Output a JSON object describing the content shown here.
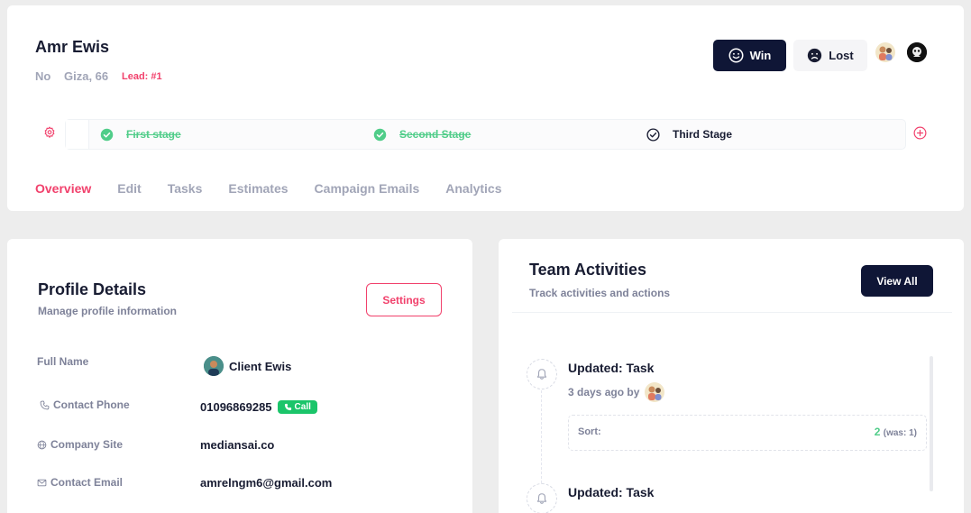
{
  "header": {
    "name": "Amr Ewis",
    "meta_no": "No",
    "meta_address": "Giza, 66",
    "lead": "Lead: #1",
    "win_label": "Win",
    "lost_label": "Lost"
  },
  "stages": [
    {
      "label": "First stage",
      "status": "done"
    },
    {
      "label": "Second Stage",
      "status": "done"
    },
    {
      "label": "Third Stage",
      "status": "current"
    }
  ],
  "tabs": [
    {
      "label": "Overview",
      "active": true
    },
    {
      "label": "Edit",
      "active": false
    },
    {
      "label": "Tasks",
      "active": false
    },
    {
      "label": "Estimates",
      "active": false
    },
    {
      "label": "Campaign Emails",
      "active": false
    },
    {
      "label": "Analytics",
      "active": false
    }
  ],
  "profile": {
    "title": "Profile Details",
    "subtitle": "Manage profile information",
    "settings_label": "Settings",
    "full_name_label": "Full Name",
    "full_name": "Client Ewis",
    "phone_label": "Contact Phone",
    "phone": "01096869285",
    "call_label": "Call",
    "site_label": "Company Site",
    "site": "mediansai.co",
    "email_label": "Contact Email",
    "email": "amrelngm6@gmail.com"
  },
  "team": {
    "title": "Team Activities",
    "subtitle": "Track activities and actions",
    "view_all_label": "View All",
    "activities": [
      {
        "title": "Updated: Task",
        "time": "3 days ago by",
        "sort_label": "Sort:",
        "sort_value": "2",
        "sort_was": "(was: 1)"
      },
      {
        "title": "Updated: Task"
      }
    ]
  },
  "colors": {
    "accent": "#f1416c",
    "dark": "#0f1636",
    "success": "#50cd89",
    "muted": "#a1a5b7"
  },
  "icons": {
    "win": "smile-icon",
    "lost": "sad-icon",
    "stage_done": "check-circle-filled-icon",
    "stage_current": "check-circle-outline-icon",
    "settings": "gear-icon",
    "add": "plus-circle-icon",
    "phone": "phone-icon",
    "site": "globe-icon",
    "email": "envelope-icon",
    "activity": "bell-icon"
  }
}
